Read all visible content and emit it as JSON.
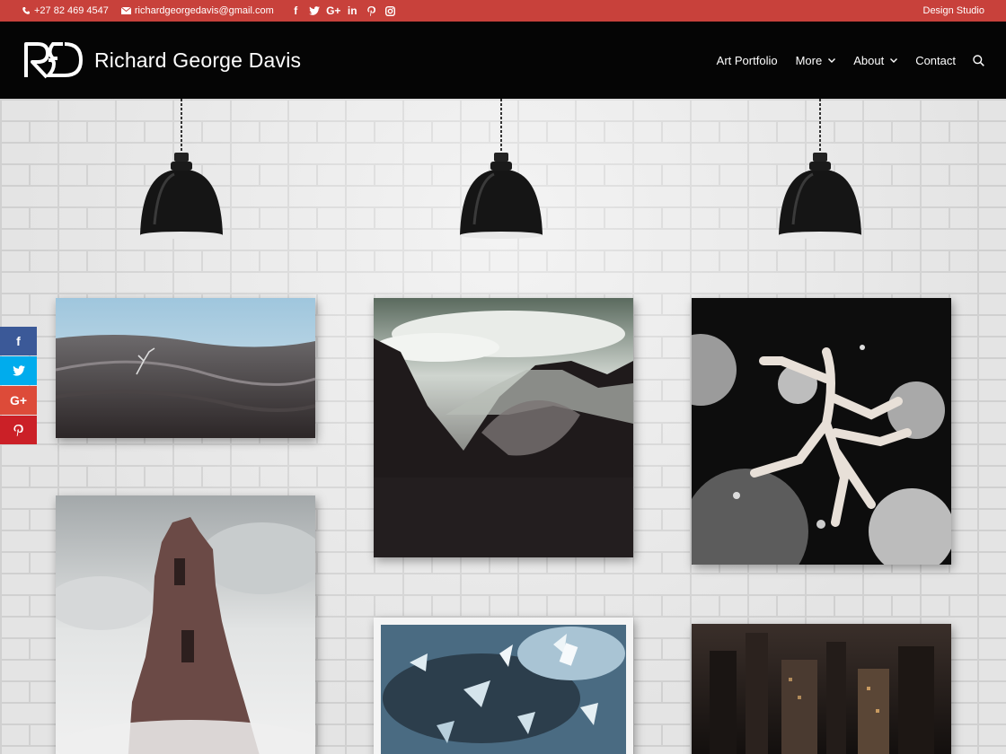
{
  "topbar": {
    "phone": "+27 82 469 4547",
    "email": "richardgeorgedavis@gmail.com",
    "social_icons": [
      "facebook-icon",
      "twitter-icon",
      "google-plus-icon",
      "linkedin-icon",
      "pinterest-icon",
      "instagram-icon"
    ],
    "right_link": "Design Studio",
    "background_color": "#c8413b"
  },
  "header": {
    "logo_text": "Richard George Davis",
    "nav": [
      {
        "label": "Art Portfolio",
        "has_dropdown": false
      },
      {
        "label": "More",
        "has_dropdown": true
      },
      {
        "label": "About",
        "has_dropdown": true
      },
      {
        "label": "Contact",
        "has_dropdown": false
      }
    ],
    "background_color": "#050505"
  },
  "share_bar": [
    {
      "icon": "facebook-icon",
      "glyph": "f",
      "color": "#3b5998"
    },
    {
      "icon": "twitter-icon",
      "glyph": "t",
      "color": "#00aced"
    },
    {
      "icon": "google-plus-icon",
      "glyph": "G+",
      "color": "#dd4b39"
    },
    {
      "icon": "pinterest-icon",
      "glyph": "p",
      "color": "#cb2027"
    }
  ],
  "gallery": [
    {
      "subject": "desert-dunes-figure"
    },
    {
      "subject": "mountain-clouds"
    },
    {
      "subject": "space-figures-planets"
    },
    {
      "subject": "ruined-tower-clouds"
    },
    {
      "subject": "shattered-glass-storm"
    },
    {
      "subject": "city-reflection"
    }
  ]
}
